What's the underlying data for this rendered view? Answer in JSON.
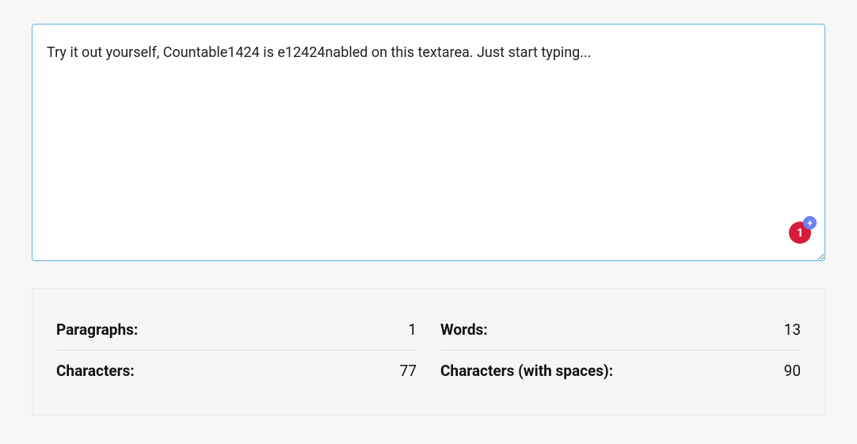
{
  "textarea": {
    "value": "Try it out yourself, Countable1424 is e12424nabled on this textarea. Just start typing...",
    "placeholder": ""
  },
  "badge": {
    "count": "1",
    "plus": "+"
  },
  "stats": {
    "paragraphs": {
      "label": "Paragraphs:",
      "value": "1"
    },
    "words": {
      "label": "Words:",
      "value": "13"
    },
    "characters": {
      "label": "Characters:",
      "value": "77"
    },
    "characters_spaces": {
      "label": "Characters (with spaces):",
      "value": "90"
    }
  }
}
